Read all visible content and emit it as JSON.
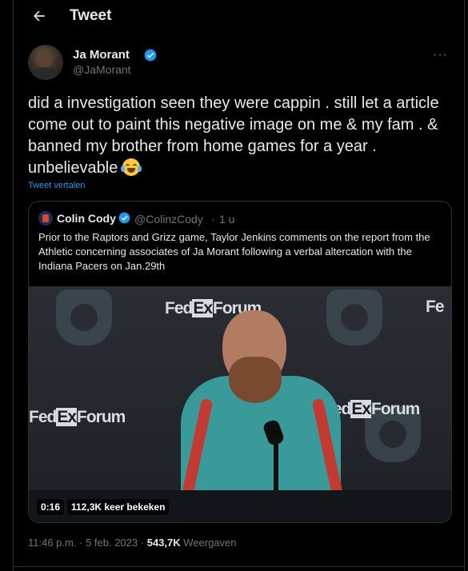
{
  "header": {
    "title": "Tweet",
    "back_icon": "arrow-left-icon"
  },
  "author": {
    "name": "Ja Morant",
    "handle": "@JaMorant",
    "verified_icon": "verified-badge-icon",
    "more_label": "···"
  },
  "tweet": {
    "text": "did a investigation seen they were cappin . still let a article come out to paint this negative image on me & my fam . & banned my brother from home games for a year . unbelievable",
    "emoji": "face-with-tears-of-joy-icon",
    "translate_label": "Tweet vertalen"
  },
  "quote": {
    "name": "Colin Cody",
    "handle": "@ColinzCody",
    "dot": "·",
    "time": "1 u",
    "text": "Prior to the Raptors and Grizz game, Taylor Jenkins comments on the report from the Athletic concerning associates of Ja Morant following a verbal altercation with the Indiana Pacers on Jan.29th",
    "video": {
      "duration": "0:16",
      "views": "112,3K keer bekeken",
      "backdrop_text": [
        "FedExForum",
        "FedExForum",
        "FedExForum",
        "Fe"
      ]
    }
  },
  "meta": {
    "time": "11:46 p.m.",
    "dot": "·",
    "date": "5 feb. 2023",
    "dot2": "·",
    "views_count": "543,7K",
    "views_label": "Weergaven"
  },
  "colors": {
    "background": "#000000",
    "text": "#e7e9ea",
    "muted": "#71767b",
    "link": "#1d9bf0",
    "verified": "#1d9bf0"
  }
}
